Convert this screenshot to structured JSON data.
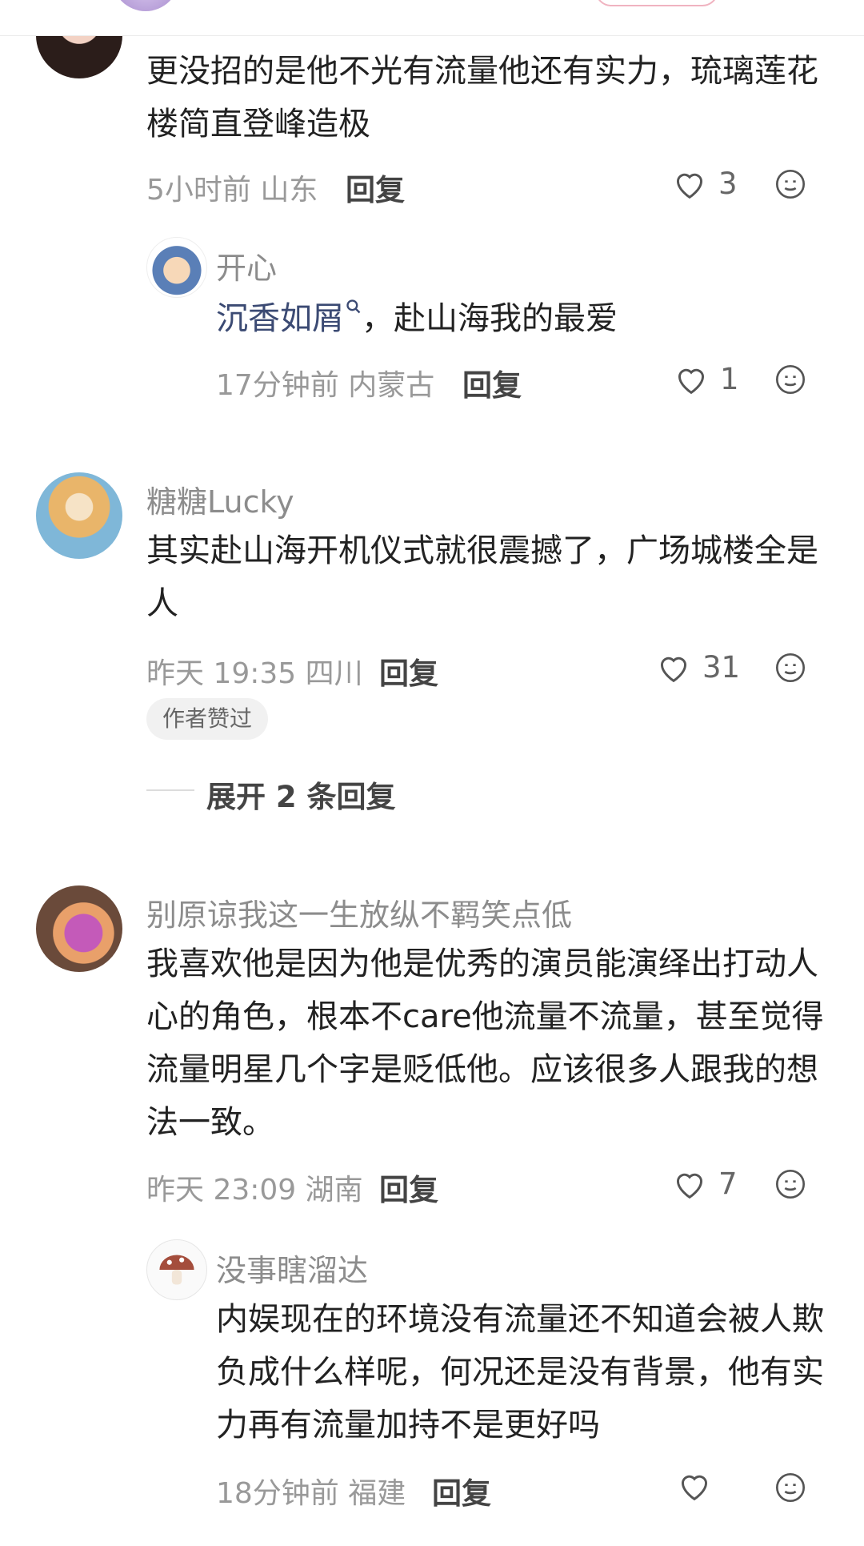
{
  "comments": [
    {
      "text": "更没招的是他不光有流量他还有实力，琉璃莲花楼简直登峰造极",
      "time": "5小时前",
      "location": "山东",
      "reply_label": "回复",
      "likes": "3",
      "replies": [
        {
          "author": "开心",
          "mention": "沉香如屑",
          "text": "，赴山海我的最爱",
          "time": "17分钟前",
          "location": "内蒙古",
          "reply_label": "回复",
          "likes": "1"
        }
      ]
    },
    {
      "author": "糖糖Lucky",
      "text": "其实赴山海开机仪式就很震撼了，广场城楼全是人",
      "time": "昨天 19:35",
      "location": "四川",
      "reply_label": "回复",
      "likes": "31",
      "badge": "作者赞过",
      "expand_label": "展开 2 条回复"
    },
    {
      "author": "别原谅我这一生放纵不羁笑点低",
      "text": "我喜欢他是因为他是优秀的演员能演绎出打动人心的角色，根本不care他流量不流量，甚至觉得流量明星几个字是贬低他。应该很多人跟我的想法一致。",
      "time": "昨天 23:09",
      "location": "湖南",
      "reply_label": "回复",
      "likes": "7",
      "replies": [
        {
          "author": "没事瞎溜达",
          "text": "内娱现在的环境没有流量还不知道会被人欺负成什么样呢，何况还是没有背景，他有实力再有流量加持不是更好吗",
          "time": "18分钟前",
          "location": "福建",
          "reply_label": "回复",
          "likes": ""
        }
      ]
    }
  ],
  "icons": {
    "like": "heart-outline-icon",
    "emoji": "smile-face-icon",
    "mention_search": "search-icon"
  }
}
